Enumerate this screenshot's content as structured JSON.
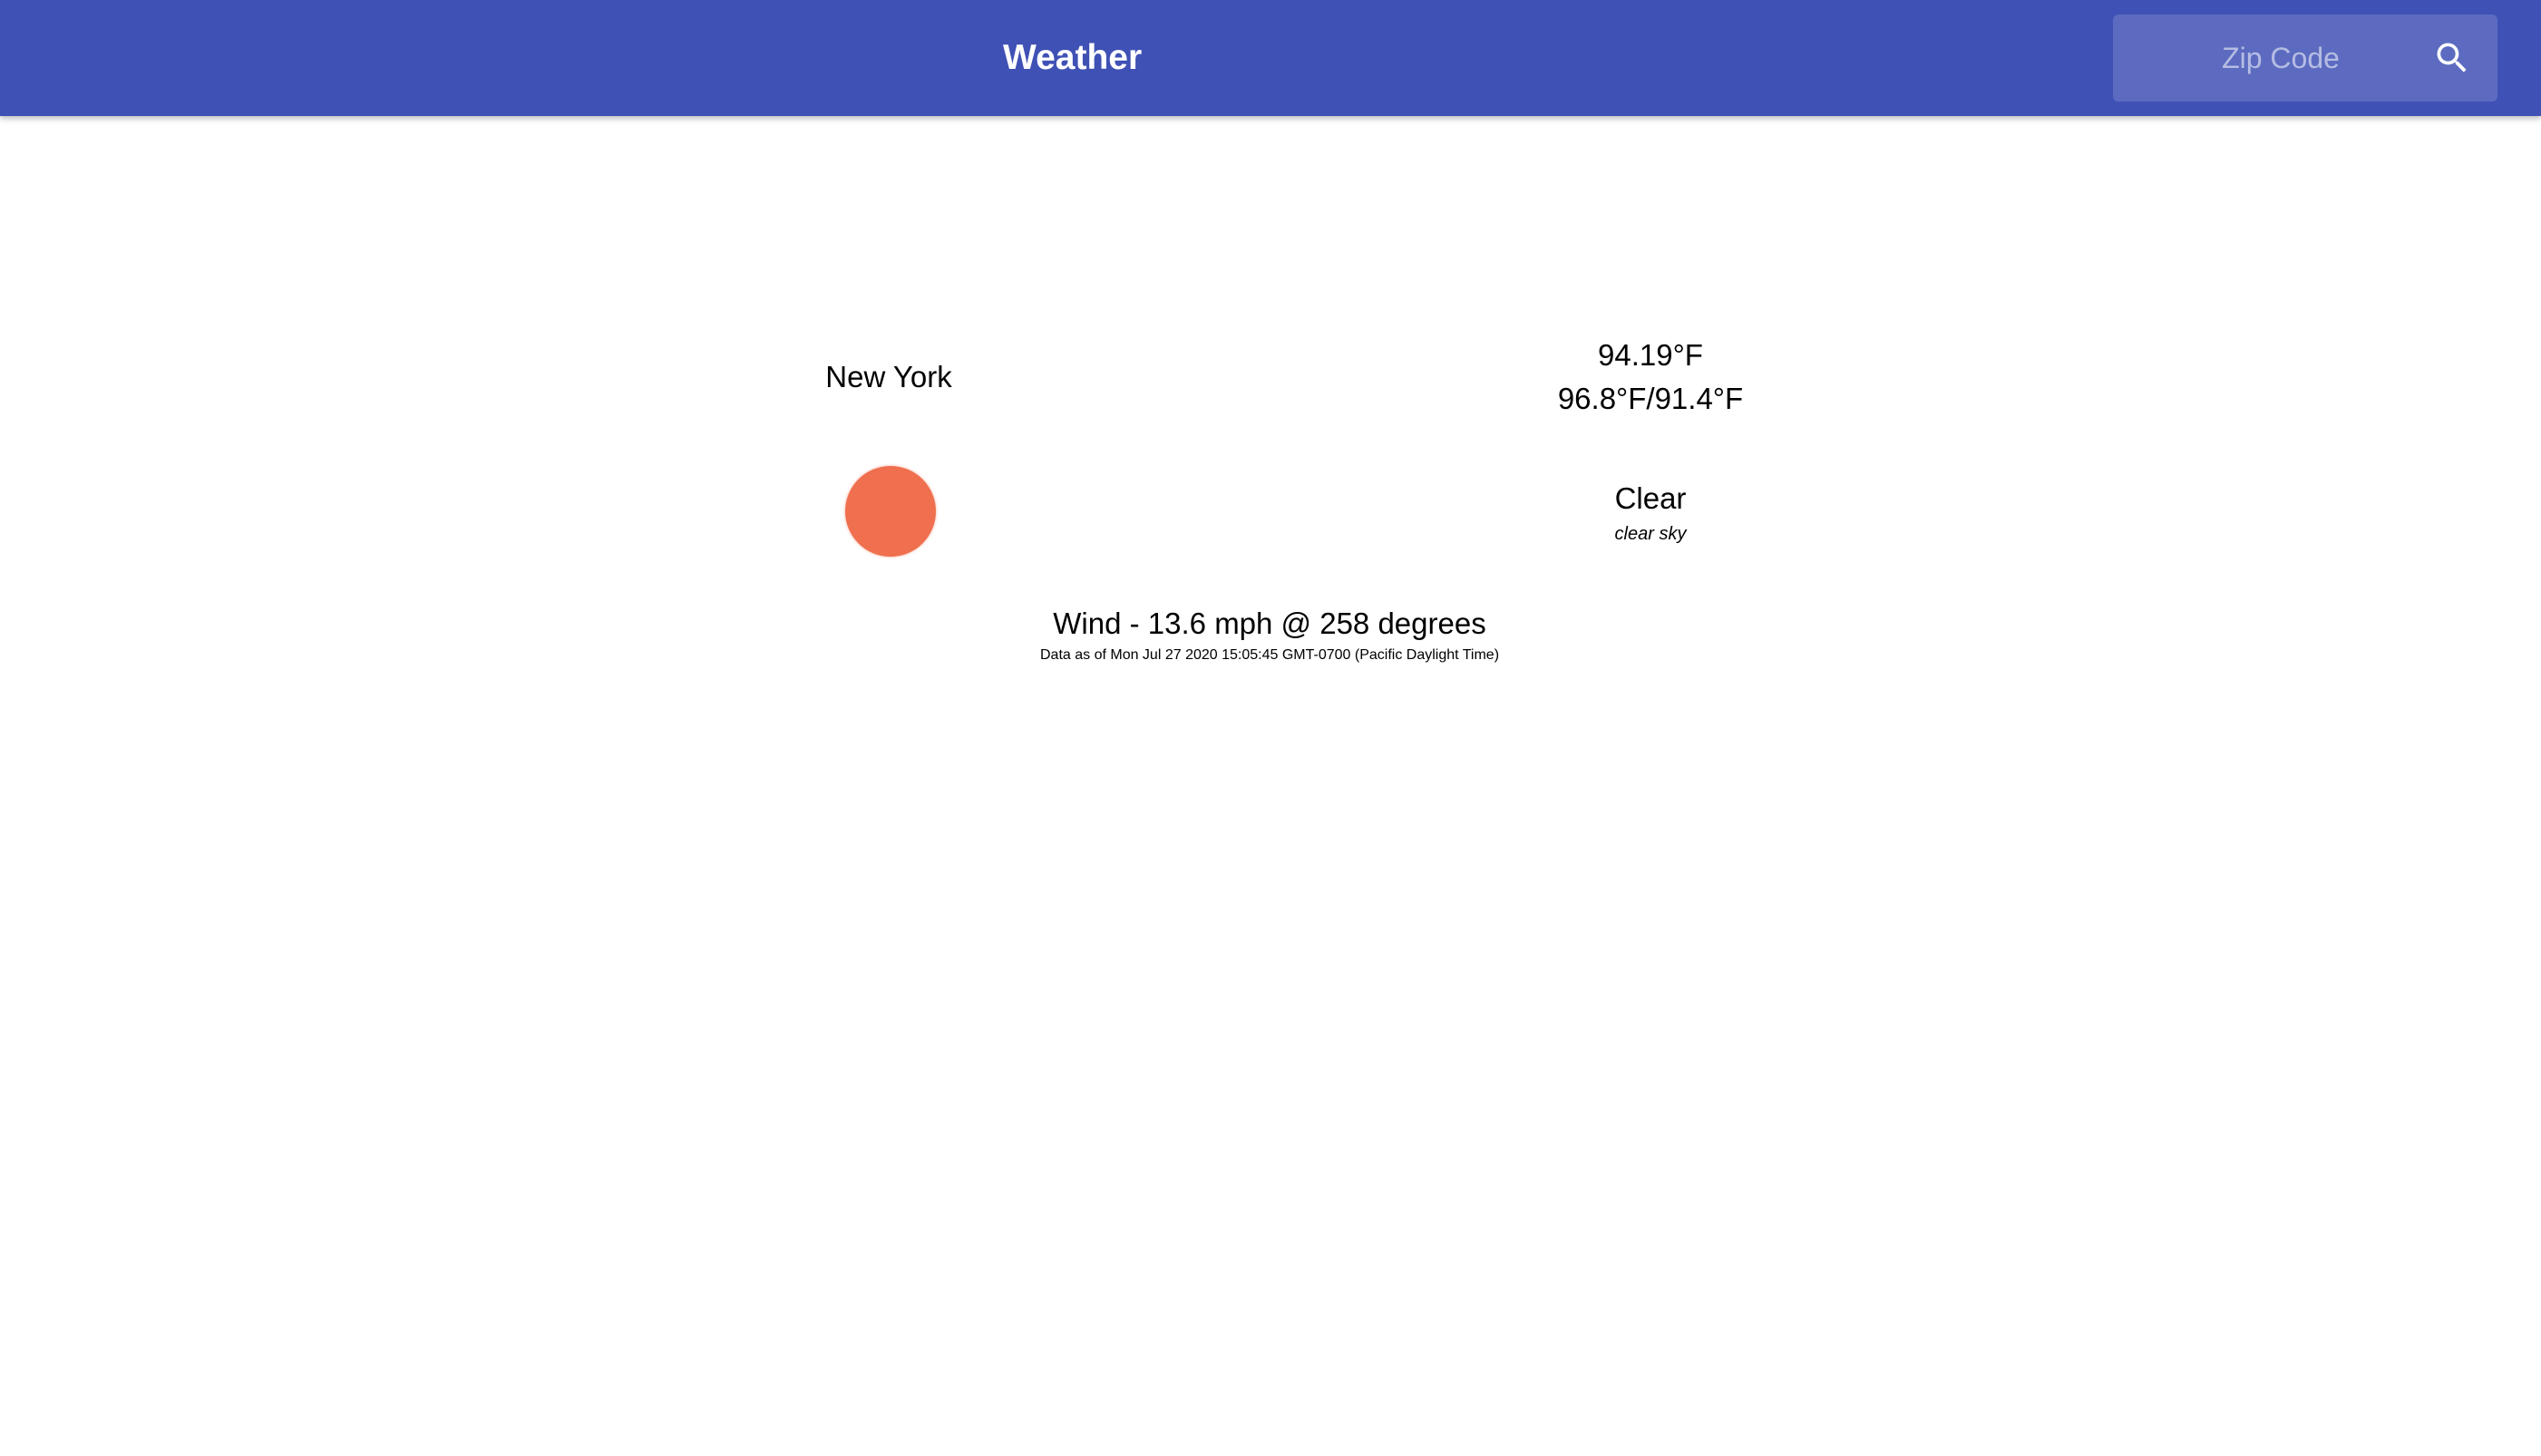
{
  "header": {
    "title": "Weather",
    "background_color": "#3f51b5",
    "search": {
      "placeholder": "Zip Code",
      "value": "",
      "icon": "search-icon"
    }
  },
  "weather": {
    "city": "New York",
    "temperature_current": "94.19°F",
    "temperature_range": "96.8°F/91.4°F",
    "icon": "sun-icon",
    "icon_color": "#ef6f4e",
    "condition": "Clear",
    "condition_description": "clear sky",
    "wind": "Wind - 13.6 mph @ 258 degrees",
    "data_timestamp": "Data as of Mon Jul 27 2020 15:05:45 GMT-0700 (Pacific Daylight Time)"
  }
}
